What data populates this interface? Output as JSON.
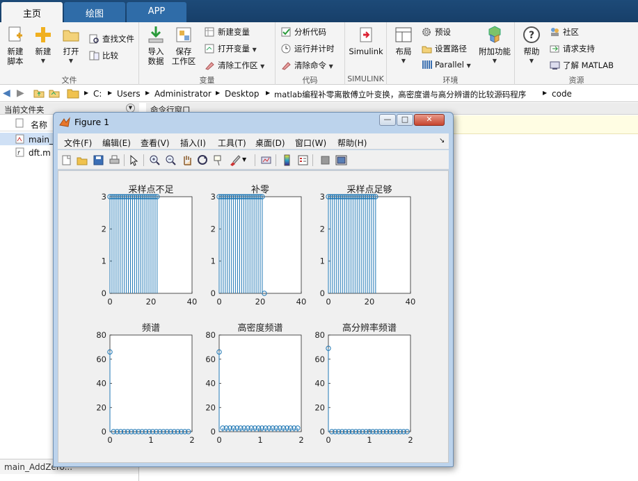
{
  "tabs": [
    {
      "label": "主页",
      "active": true
    },
    {
      "label": "绘图",
      "active": false
    },
    {
      "label": "APP",
      "active": false
    }
  ],
  "ribbon": {
    "groups": {
      "file": "文件",
      "variable": "变量",
      "code": "代码",
      "simulink": "SIMULINK",
      "environment": "环境",
      "resources": "资源"
    },
    "new_script": "新建\n脚本",
    "new": "新建",
    "open": "打开",
    "find_files": "查找文件",
    "compare": "比较",
    "import_data": "导入\n数据",
    "save_workspace": "保存\n工作区",
    "new_variable": "新建变量",
    "open_variable": "打开变量",
    "clear_workspace": "清除工作区",
    "analyze_code": "分析代码",
    "run_and_time": "运行并计时",
    "clear_commands": "清除命令",
    "simulink": "Simulink",
    "layout": "布局",
    "preferences": "预设",
    "set_path": "设置路径",
    "parallel": "Parallel",
    "addons": "附加功能",
    "help": "帮助",
    "community": "社区",
    "request_support": "请求支持",
    "learn_matlab": "了解 MATLAB"
  },
  "address": {
    "segments": [
      "C:",
      "Users",
      "Administrator",
      "Desktop",
      "matlab编程补零离散傅立叶变换，高密度谱与高分辨谱的比较源码程序",
      "code"
    ]
  },
  "current_folder": {
    "title": "当前文件夹",
    "name_header": "名称",
    "files": [
      "main_",
      "dft.m"
    ],
    "status_file": "main_AddZero..."
  },
  "command_window": {
    "title": "命令行窗口"
  },
  "figure": {
    "title": "Figure 1",
    "menu": [
      "文件(F)",
      "编辑(E)",
      "查看(V)",
      "插入(I)",
      "工具(T)",
      "桌面(D)",
      "窗口(W)",
      "帮助(H)"
    ],
    "toolbar_icons": [
      "new-figure-icon",
      "open-icon",
      "save-icon",
      "print-icon",
      "pointer-icon",
      "zoom-in-icon",
      "zoom-out-icon",
      "pan-icon",
      "rotate-icon",
      "data-cursor-icon",
      "brush-icon",
      "link-icon",
      "colorbar-icon",
      "legend-icon",
      "hide-plot-tools-icon",
      "show-plot-tools-icon"
    ]
  },
  "colors": {
    "stem": "#1f77b4",
    "ribbon_tab": "#173f69",
    "info_bar": "#fffde3"
  },
  "chart_data": [
    {
      "type": "stem",
      "title": "采样点不足",
      "xlim": [
        0,
        40
      ],
      "ylim": [
        0,
        3
      ],
      "xticks": [
        0,
        20,
        40
      ],
      "yticks": [
        0,
        1,
        2,
        3
      ],
      "x": [
        0,
        1,
        2,
        3,
        4,
        5,
        6,
        7,
        8,
        9,
        10,
        11,
        12,
        13,
        14,
        15,
        16,
        17,
        18,
        19,
        20,
        21,
        22,
        23
      ],
      "y": [
        3,
        3,
        3,
        3,
        3,
        3,
        3,
        3,
        3,
        3,
        3,
        3,
        3,
        3,
        3,
        3,
        3,
        3,
        3,
        3,
        3,
        3,
        3,
        3
      ]
    },
    {
      "type": "stem",
      "title": "补零",
      "xlim": [
        0,
        40
      ],
      "ylim": [
        0,
        3
      ],
      "xticks": [
        0,
        20,
        40
      ],
      "yticks": [
        0,
        1,
        2,
        3
      ],
      "x": [
        0,
        1,
        2,
        3,
        4,
        5,
        6,
        7,
        8,
        9,
        10,
        11,
        12,
        13,
        14,
        15,
        16,
        17,
        18,
        19,
        20,
        21,
        22
      ],
      "y": [
        3,
        3,
        3,
        3,
        3,
        3,
        3,
        3,
        3,
        3,
        3,
        3,
        3,
        3,
        3,
        3,
        3,
        3,
        3,
        3,
        3,
        3,
        0
      ]
    },
    {
      "type": "stem",
      "title": "采样点足够",
      "xlim": [
        0,
        40
      ],
      "ylim": [
        0,
        3
      ],
      "xticks": [
        0,
        20,
        40
      ],
      "yticks": [
        0,
        1,
        2,
        3
      ],
      "x": [
        0,
        1,
        2,
        3,
        4,
        5,
        6,
        7,
        8,
        9,
        10,
        11,
        12,
        13,
        14,
        15,
        16,
        17,
        18,
        19,
        20,
        21,
        22,
        23
      ],
      "y": [
        3,
        3,
        3,
        3,
        3,
        3,
        3,
        3,
        3,
        3,
        3,
        3,
        3,
        3,
        3,
        3,
        3,
        3,
        3,
        3,
        3,
        3,
        3,
        3
      ]
    },
    {
      "type": "stem",
      "title": "频谱",
      "xlim": [
        0,
        2
      ],
      "ylim": [
        0,
        80
      ],
      "xticks": [
        0,
        1,
        2
      ],
      "yticks": [
        0,
        20,
        40,
        60,
        80
      ],
      "x": [
        0,
        0.087,
        0.174,
        0.261,
        0.348,
        0.435,
        0.522,
        0.609,
        0.696,
        0.783,
        0.87,
        0.957,
        1.043,
        1.13,
        1.217,
        1.304,
        1.391,
        1.478,
        1.565,
        1.652,
        1.739,
        1.826,
        1.913
      ],
      "y": [
        66,
        0,
        0,
        0,
        0,
        0,
        0,
        0,
        0,
        0,
        0,
        0,
        0,
        0,
        0,
        0,
        0,
        0,
        0,
        0,
        0,
        0,
        0
      ]
    },
    {
      "type": "stem",
      "title": "高密度频谱",
      "xlim": [
        0,
        2
      ],
      "ylim": [
        0,
        80
      ],
      "xticks": [
        0,
        1,
        2
      ],
      "yticks": [
        0,
        20,
        40,
        60,
        80
      ],
      "x": [
        0,
        0.087,
        0.174,
        0.261,
        0.348,
        0.435,
        0.522,
        0.609,
        0.696,
        0.783,
        0.87,
        0.957,
        1.043,
        1.13,
        1.217,
        1.304,
        1.391,
        1.478,
        1.565,
        1.652,
        1.739,
        1.826,
        1.913
      ],
      "y": [
        66,
        3,
        3,
        3,
        3,
        3,
        3,
        3,
        3,
        3,
        3,
        3,
        3,
        3,
        3,
        3,
        3,
        3,
        3,
        3,
        3,
        3,
        3
      ]
    },
    {
      "type": "stem",
      "title": "高分辨率频谱",
      "xlim": [
        0,
        2
      ],
      "ylim": [
        0,
        80
      ],
      "xticks": [
        0,
        1,
        2
      ],
      "yticks": [
        0,
        20,
        40,
        60,
        80
      ],
      "x": [
        0,
        0.083,
        0.167,
        0.25,
        0.333,
        0.417,
        0.5,
        0.583,
        0.667,
        0.75,
        0.833,
        0.917,
        1.0,
        1.083,
        1.167,
        1.25,
        1.333,
        1.417,
        1.5,
        1.583,
        1.667,
        1.75,
        1.833,
        1.917
      ],
      "y": [
        69,
        0,
        0,
        0,
        0,
        0,
        0,
        0,
        0,
        0,
        0,
        0,
        0,
        0,
        0,
        0,
        0,
        0,
        0,
        0,
        0,
        0,
        0,
        0
      ]
    }
  ]
}
